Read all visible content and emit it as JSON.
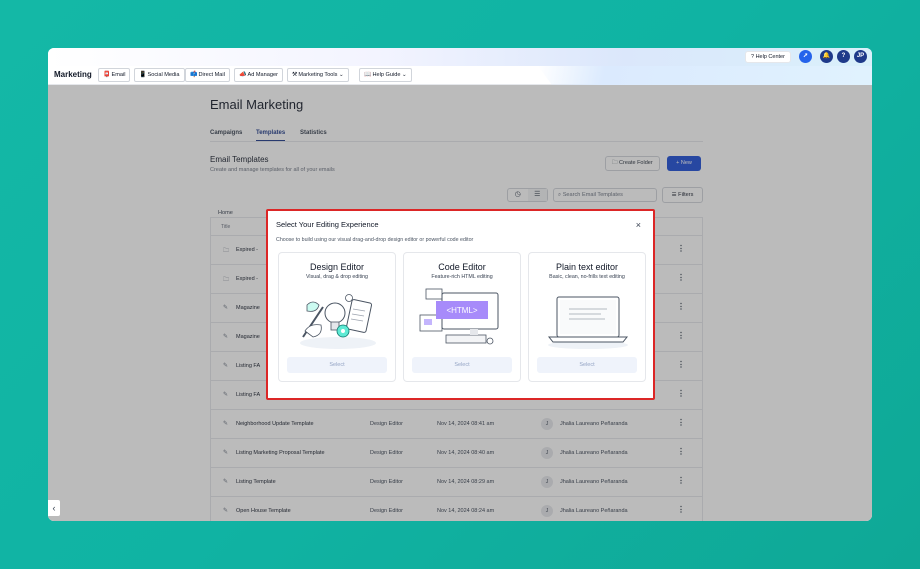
{
  "topbar": {
    "help_center": "? Help Center",
    "avatar": "JP",
    "help": "?"
  },
  "navbar": {
    "brand": "Marketing",
    "items": [
      {
        "icon": "📮",
        "label": "Email"
      },
      {
        "icon": "📱",
        "label": "Social Media"
      },
      {
        "icon": "📫",
        "label": "Direct Mail"
      },
      {
        "icon": "📣",
        "label": "Ad Manager"
      },
      {
        "icon": "⚒",
        "label": "Marketing Tools",
        "chevron": "⌄"
      },
      {
        "icon": "📖",
        "label": "Help Guide",
        "chevron": "⌄"
      }
    ]
  },
  "page": {
    "title": "Email Marketing",
    "tabs": [
      "Campaigns",
      "Templates",
      "Statistics"
    ],
    "active_tab": "Templates",
    "section_title": "Email Templates",
    "section_sub": "Create and manage templates for all of your emails",
    "create_folder": "Create Folder",
    "new": "+ New",
    "search_placeholder": "Search Email Templates",
    "filters": "Filters",
    "breadcrumb": "Home",
    "column_title": "Title"
  },
  "rows": [
    {
      "icon": "folder",
      "name": "Expired - ",
      "type": "",
      "date": "",
      "owner": ""
    },
    {
      "icon": "folder",
      "name": "Expired - ",
      "type": "",
      "date": "",
      "owner": ""
    },
    {
      "icon": "pencil",
      "name": "Magazine",
      "type": "",
      "date": "",
      "owner": ""
    },
    {
      "icon": "pencil",
      "name": "Magazine",
      "type": "",
      "date": "",
      "owner": ""
    },
    {
      "icon": "pencil",
      "name": "Listing FA",
      "type": "",
      "date": "",
      "owner": ""
    },
    {
      "icon": "pencil",
      "name": "Listing FA",
      "type": "",
      "date": "",
      "owner": ""
    },
    {
      "icon": "pencil",
      "name": "Neighborhood Update Template",
      "type": "Design Editor",
      "date": "Nov 14, 2024 08:41 am",
      "avatar": "J",
      "owner": "Jhalia Laureano Peñaranda"
    },
    {
      "icon": "pencil",
      "name": "Listing Marketing Proposal Template",
      "type": "Design Editor",
      "date": "Nov 14, 2024 08:40 am",
      "avatar": "J",
      "owner": "Jhalia Laureano Peñaranda"
    },
    {
      "icon": "pencil",
      "name": "Listing Template",
      "type": "Design Editor",
      "date": "Nov 14, 2024 08:29 am",
      "avatar": "J",
      "owner": "Jhalia Laureano Peñaranda"
    },
    {
      "icon": "pencil",
      "name": "Open House Template",
      "type": "Design Editor",
      "date": "Nov 14, 2024 08:24 am",
      "avatar": "J",
      "owner": "Jhalia Laureano Peñaranda"
    }
  ],
  "modal": {
    "title": "Select Your Editing Experience",
    "subtitle": "Choose to build using our visual drag-and-drop design editor or powerful code editor",
    "close": "×",
    "cards": [
      {
        "title": "Design Editor",
        "subtitle": "Visual, drag & drop editing",
        "select": "Select"
      },
      {
        "title": "Code Editor",
        "subtitle": "Feature-rich HTML editing",
        "select": "Select",
        "badge": "<HTML>"
      },
      {
        "title": "Plain text editor",
        "subtitle": "Basic, clean, no-frills text editing",
        "select": "Select"
      }
    ]
  },
  "colors": {
    "background": "#14b8a6",
    "primary": "#1d4ed8",
    "highlight_border": "#dc2626",
    "code_purple": "#a78bfa",
    "design_teal": "#5eead4"
  }
}
